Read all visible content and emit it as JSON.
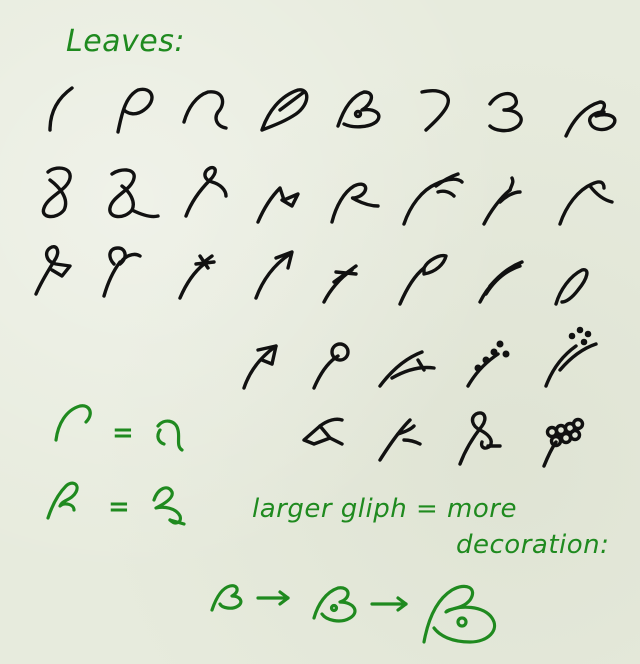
{
  "title": "Leaves:",
  "note_line1": "larger gliph = more",
  "note_line2": "decoration:",
  "equals_sign": "=",
  "colors": {
    "ink": "#111111",
    "annotation": "#1f8a1f",
    "paper": "#e7ebdd"
  }
}
